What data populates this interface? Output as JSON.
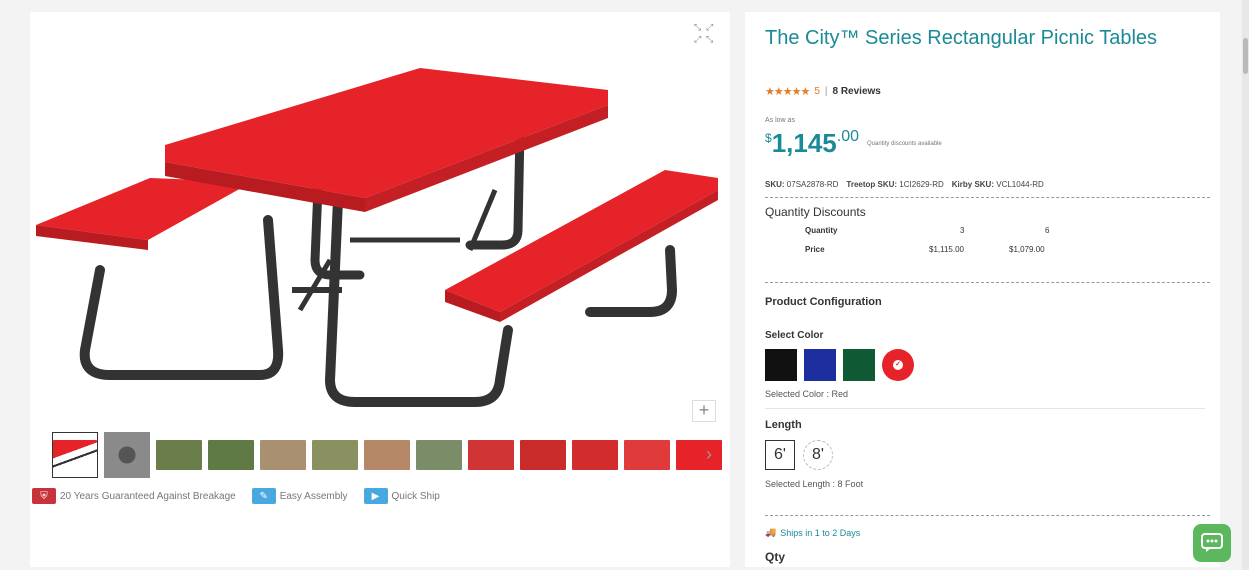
{
  "product": {
    "title": "The City™ Series Rectangular Picnic Tables",
    "rating_stars": "★★★★★",
    "rating_value": "5",
    "rating_sep": "|",
    "reviews_label": "8 Reviews",
    "as_low_as": "As low as",
    "price_currency": "$",
    "price_dollars": "1,145",
    "price_cents": ".00",
    "quantity_discounts_note": "Quantity discounts available"
  },
  "skus": [
    {
      "label": "SKU:",
      "value": "07SA2878-RD"
    },
    {
      "label": "Treetop SKU:",
      "value": "1CI2629-RD"
    },
    {
      "label": "Kirby SKU:",
      "value": "VCL1044-RD"
    }
  ],
  "quantity_discounts": {
    "title": "Quantity Discounts",
    "quantity_label": "Quantity",
    "price_label": "Price",
    "quantities": [
      "3",
      "6"
    ],
    "prices": [
      "$1,115.00",
      "$1,079.00"
    ]
  },
  "config": {
    "title": "Product Configuration",
    "color_label": "Select Color",
    "colors": [
      {
        "name": "Black",
        "hex": "#111111"
      },
      {
        "name": "Blue",
        "hex": "#1d2f9e"
      },
      {
        "name": "Green",
        "hex": "#0f5a34"
      },
      {
        "name": "Red",
        "hex": "#e52329"
      }
    ],
    "selected_color": "Selected Color : Red",
    "length_label": "Length",
    "lengths": [
      "6'",
      "8'"
    ],
    "selected_length": "Selected Length : 8 Foot"
  },
  "shipping": {
    "label": "Ships in 1 to 2 Days"
  },
  "qty_label": "Qty",
  "gallery": {
    "zoom_label": "+",
    "next_label": "›",
    "thumb_colors": [
      "#ffffff",
      "#8a8a8a",
      "#6b7d4a",
      "#5f7a45",
      "#a99070",
      "#8b9060",
      "#b48866",
      "#7a8c68",
      "#d03434",
      "#c92a2a",
      "#d32c2c",
      "#e03a3a",
      "#e52329"
    ]
  },
  "badges": [
    {
      "label": "20 Years Guaranteed Against Breakage",
      "color": "#c8323a",
      "icon": "shield-icon"
    },
    {
      "label": "Easy Assembly",
      "color": "#4aa8e0",
      "icon": "wrench-icon"
    },
    {
      "label": "Quick Ship",
      "color": "#4aa8e0",
      "icon": "truck-icon"
    }
  ],
  "colors": {
    "accent": "#1a8a96",
    "star": "#e37c22",
    "chat": "#5cb85c"
  }
}
